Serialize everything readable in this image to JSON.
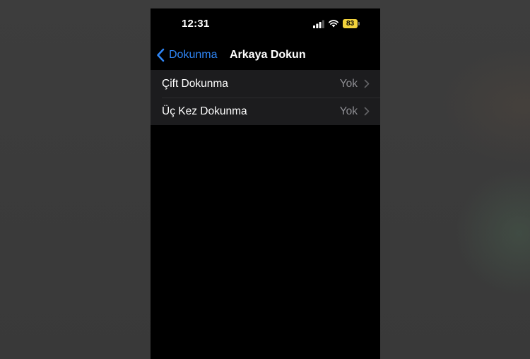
{
  "status_bar": {
    "time": "12:31",
    "battery_level": "83",
    "icons": [
      "signal-icon",
      "wifi-icon",
      "battery-icon"
    ]
  },
  "nav": {
    "back_label": "Dokunma",
    "title": "Arkaya Dokun"
  },
  "rows": [
    {
      "label": "Çift Dokunma",
      "value": "Yok"
    },
    {
      "label": "Üç Kez Dokunma",
      "value": "Yok"
    }
  ],
  "colors": {
    "accent": "#2f86f6",
    "battery": "#f2d23c",
    "background": "#000000",
    "row_background": "#1c1c1e",
    "secondary_text": "#8e8e93"
  }
}
